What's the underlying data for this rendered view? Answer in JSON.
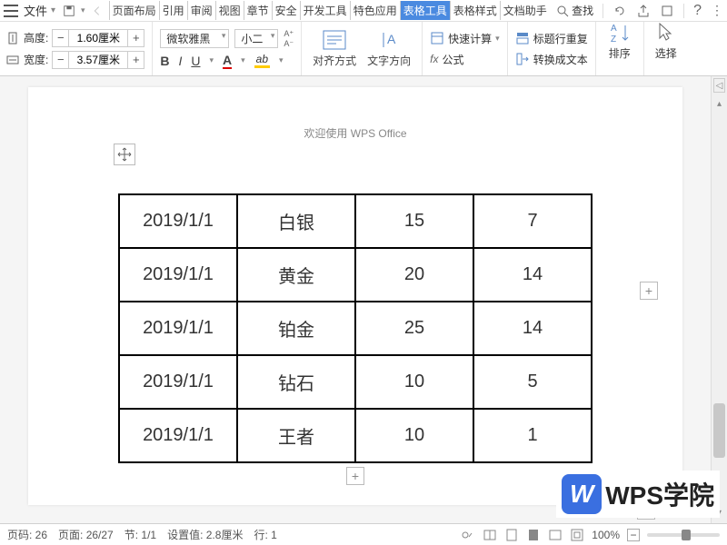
{
  "menu": {
    "file": "文件",
    "tabs": [
      "页面布局",
      "引用",
      "审阅",
      "视图",
      "章节",
      "安全",
      "开发工具",
      "特色应用",
      "表格工具",
      "表格样式",
      "文档助手"
    ],
    "active_tab_index": 8,
    "search": "查找"
  },
  "ribbon": {
    "height_label": "高度:",
    "height_value": "1.60厘米",
    "width_label": "宽度:",
    "width_value": "3.57厘米",
    "font_name": "微软雅黑",
    "font_size": "小二",
    "bold": "B",
    "italic": "I",
    "underline": "U",
    "fontcolor": "A",
    "highlight": "ab",
    "align_label": "对齐方式",
    "text_dir_label": "文字方向",
    "quick_calc": "快速计算",
    "formula": "公式",
    "header_repeat": "标题行重复",
    "to_text": "转换成文本",
    "sort": "排序",
    "select": "选择",
    "fx": "fx"
  },
  "document": {
    "welcome": "欢迎使用 WPS Office",
    "table": {
      "rows": [
        [
          "2019/1/1",
          "白银",
          "15",
          "7"
        ],
        [
          "2019/1/1",
          "黄金",
          "20",
          "14"
        ],
        [
          "2019/1/1",
          "铂金",
          "25",
          "14"
        ],
        [
          "2019/1/1",
          "钻石",
          "10",
          "5"
        ],
        [
          "2019/1/1",
          "王者",
          "10",
          "1"
        ]
      ]
    }
  },
  "statusbar": {
    "page_no": "页码: 26",
    "page": "页面: 26/27",
    "section": "节: 1/1",
    "indent": "设置值: 2.8厘米",
    "row": "行: 1",
    "zoom": "100%"
  },
  "watermark": "WPS学院"
}
